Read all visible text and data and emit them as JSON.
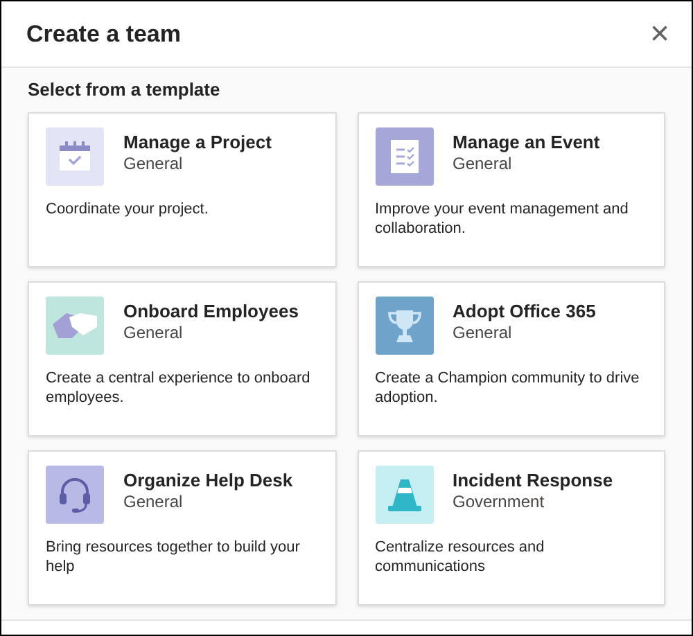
{
  "dialog": {
    "title": "Create a team",
    "close": "×"
  },
  "section": {
    "heading": "Select from a template"
  },
  "templates": [
    {
      "title": "Manage a Project",
      "category": "General",
      "description": "Coordinate your project."
    },
    {
      "title": "Manage an Event",
      "category": "General",
      "description": "Improve your event management and collaboration."
    },
    {
      "title": "Onboard Employees",
      "category": "General",
      "description": "Create a central experience to onboard employees."
    },
    {
      "title": "Adopt Office 365",
      "category": "General",
      "description": "Create a Champion community to drive adoption."
    },
    {
      "title": "Organize Help Desk",
      "category": "General",
      "description": "Bring resources together to build your help"
    },
    {
      "title": "Incident Response",
      "category": "Government",
      "description": "Centralize resources and communications"
    }
  ]
}
